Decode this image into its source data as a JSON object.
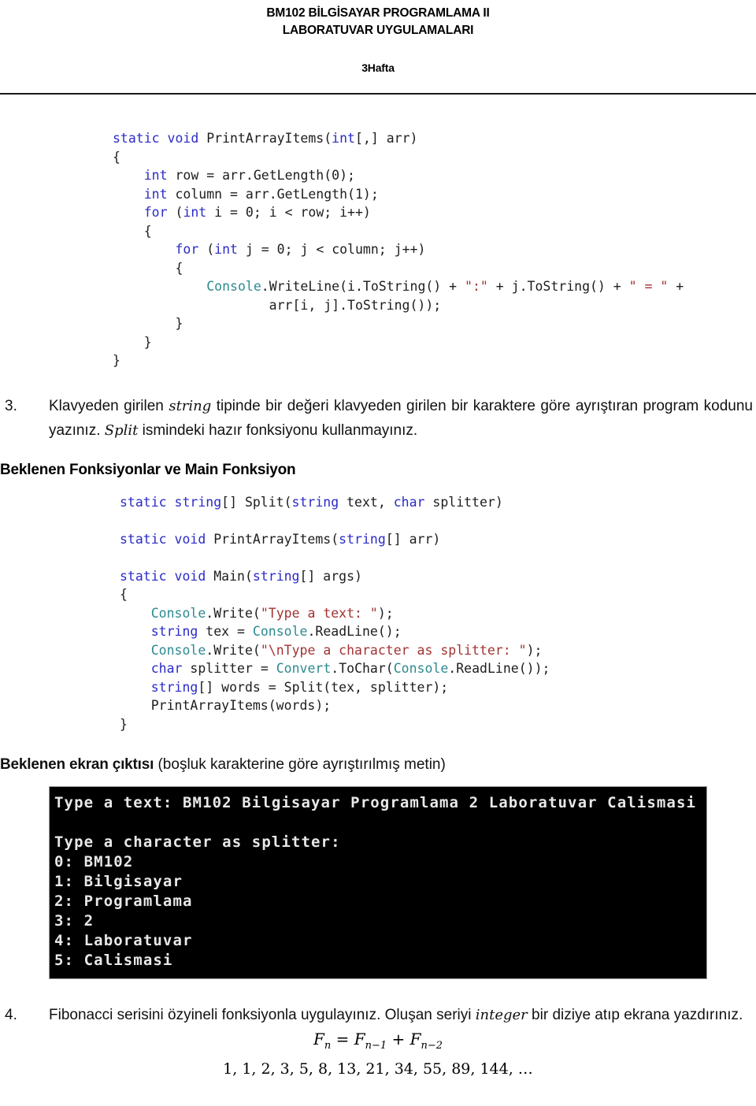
{
  "header": {
    "title_line1": "BM102 BİLGİSAYAR PROGRAMLAMA II",
    "title_line2": "LABORATUVAR UYGULAMALARI",
    "week": "3Hafta"
  },
  "code_block_1": {
    "lines": [
      [
        {
          "t": "static void ",
          "c": "kw"
        },
        {
          "t": "PrintArrayItems(",
          "c": ""
        },
        {
          "t": "int",
          "c": "kw"
        },
        {
          "t": "[,] arr)",
          "c": ""
        }
      ],
      [
        {
          "t": "{",
          "c": ""
        }
      ],
      [
        {
          "t": "    ",
          "c": ""
        },
        {
          "t": "int",
          "c": "kw"
        },
        {
          "t": " row = arr.GetLength(0);",
          "c": ""
        }
      ],
      [
        {
          "t": "    ",
          "c": ""
        },
        {
          "t": "int",
          "c": "kw"
        },
        {
          "t": " column = arr.GetLength(1);",
          "c": ""
        }
      ],
      [
        {
          "t": "    ",
          "c": ""
        },
        {
          "t": "for",
          "c": "kw"
        },
        {
          "t": " (",
          "c": ""
        },
        {
          "t": "int",
          "c": "kw"
        },
        {
          "t": " i = 0; i < row; i++)",
          "c": ""
        }
      ],
      [
        {
          "t": "    {",
          "c": ""
        }
      ],
      [
        {
          "t": "        ",
          "c": ""
        },
        {
          "t": "for",
          "c": "kw"
        },
        {
          "t": " (",
          "c": ""
        },
        {
          "t": "int",
          "c": "kw"
        },
        {
          "t": " j = 0; j < column; j++)",
          "c": ""
        }
      ],
      [
        {
          "t": "        {",
          "c": ""
        }
      ],
      [
        {
          "t": "            ",
          "c": ""
        },
        {
          "t": "Console",
          "c": "cls"
        },
        {
          "t": ".WriteLine(i.ToString() + ",
          "c": ""
        },
        {
          "t": "\":\"",
          "c": "str"
        },
        {
          "t": " + j.ToString() + ",
          "c": ""
        },
        {
          "t": "\" = \"",
          "c": "str"
        },
        {
          "t": " +",
          "c": ""
        }
      ],
      [
        {
          "t": "                    arr[i, j].ToString());",
          "c": ""
        }
      ],
      [
        {
          "t": "        }",
          "c": ""
        }
      ],
      [
        {
          "t": "    }",
          "c": ""
        }
      ],
      [
        {
          "t": "}",
          "c": ""
        }
      ]
    ]
  },
  "question3": {
    "number": "3.",
    "text_parts": [
      {
        "t": "Klavyeden girilen ",
        "style": "normal"
      },
      {
        "t": "string",
        "style": "math"
      },
      {
        "t": " tipinde bir değeri klavyeden girilen bir karaktere göre ayrıştıran program kodunu yazınız. ",
        "style": "normal"
      },
      {
        "t": "Split",
        "style": "math"
      },
      {
        "t": " ismindeki hazır fonksiyonu kullanmayınız.",
        "style": "normal"
      }
    ],
    "section_heading": "Beklenen Fonksiyonlar ve Main Fonksiyon"
  },
  "code_block_2": {
    "lines": [
      [
        {
          "t": "static string",
          "c": "kw"
        },
        {
          "t": "[] Split(",
          "c": ""
        },
        {
          "t": "string",
          "c": "kw"
        },
        {
          "t": " text, ",
          "c": ""
        },
        {
          "t": "char",
          "c": "kw"
        },
        {
          "t": " splitter)",
          "c": ""
        }
      ],
      [],
      [
        {
          "t": "static void ",
          "c": "kw"
        },
        {
          "t": "PrintArrayItems(",
          "c": ""
        },
        {
          "t": "string",
          "c": "kw"
        },
        {
          "t": "[] arr)",
          "c": ""
        }
      ],
      [],
      [
        {
          "t": "static void ",
          "c": "kw"
        },
        {
          "t": "Main(",
          "c": ""
        },
        {
          "t": "string",
          "c": "kw"
        },
        {
          "t": "[] args)",
          "c": ""
        }
      ],
      [
        {
          "t": "{",
          "c": ""
        }
      ],
      [
        {
          "t": "    ",
          "c": ""
        },
        {
          "t": "Console",
          "c": "cls"
        },
        {
          "t": ".Write(",
          "c": ""
        },
        {
          "t": "\"Type a text: \"",
          "c": "str"
        },
        {
          "t": ");",
          "c": ""
        }
      ],
      [
        {
          "t": "    ",
          "c": ""
        },
        {
          "t": "string",
          "c": "kw"
        },
        {
          "t": " tex = ",
          "c": ""
        },
        {
          "t": "Console",
          "c": "cls"
        },
        {
          "t": ".ReadLine();",
          "c": ""
        }
      ],
      [
        {
          "t": "    ",
          "c": ""
        },
        {
          "t": "Console",
          "c": "cls"
        },
        {
          "t": ".Write(",
          "c": ""
        },
        {
          "t": "\"\\nType a character as splitter: \"",
          "c": "str"
        },
        {
          "t": ");",
          "c": ""
        }
      ],
      [
        {
          "t": "    ",
          "c": ""
        },
        {
          "t": "char",
          "c": "kw"
        },
        {
          "t": " splitter = ",
          "c": ""
        },
        {
          "t": "Convert",
          "c": "cls"
        },
        {
          "t": ".ToChar(",
          "c": ""
        },
        {
          "t": "Console",
          "c": "cls"
        },
        {
          "t": ".ReadLine());",
          "c": ""
        }
      ],
      [
        {
          "t": "    ",
          "c": ""
        },
        {
          "t": "string",
          "c": "kw"
        },
        {
          "t": "[] words = Split(tex, splitter);",
          "c": ""
        }
      ],
      [
        {
          "t": "    PrintArrayItems(words);",
          "c": ""
        }
      ],
      [
        {
          "t": "}",
          "c": ""
        }
      ]
    ]
  },
  "output_section": {
    "label_bold": "Beklenen ekran çıktısı",
    "label_rest": " (boşluk karakterine göre ayrıştırılmış metin)"
  },
  "console": {
    "lines": [
      "Type a text: BM102 Bilgisayar Programlama 2 Laboratuvar Calismasi",
      "",
      "Type a character as splitter:",
      "0: BM102",
      "1: Bilgisayar",
      "2: Programlama",
      "3: 2",
      "4: Laboratuvar",
      "5: Calismasi"
    ],
    "background": "#000000",
    "foreground": "#e8e8e8"
  },
  "question4": {
    "number": "4.",
    "text_parts": [
      {
        "t": "Fibonacci serisini özyineli fonksiyonla uygulayınız. Oluşan seriyi ",
        "style": "normal"
      },
      {
        "t": "integer",
        "style": "math"
      },
      {
        "t": " bir diziye atıp ekrana yazdırınız.",
        "style": "normal"
      }
    ],
    "formula_main": "F",
    "formula_sub_n": "n",
    "formula_eq": " = F",
    "formula_sub_n1": "n−1",
    "formula_plus": " + F",
    "formula_sub_n2": "n−2",
    "series": "1, 1, 2, 3, 5, 8, 13, 21, 34, 55, 89, 144, …"
  },
  "colors": {
    "keyword": "#2b2bc6",
    "class": "#2d8a8f",
    "string": "#a33232",
    "text": "#1d1d1d"
  }
}
